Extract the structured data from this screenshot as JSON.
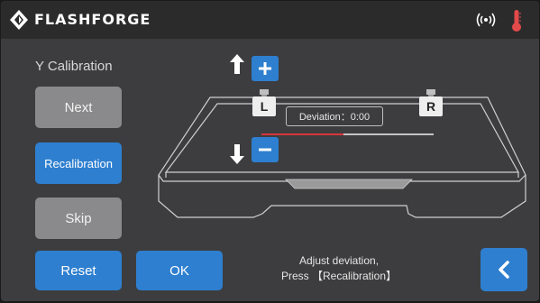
{
  "header": {
    "brand": "FLASHFORGE",
    "logo_icon": "flashforge-logo-icon",
    "wifi_icon": "wifi-signal-icon",
    "temperature_icon": "thermometer-icon"
  },
  "page": {
    "title": "Y Calibration"
  },
  "buttons": {
    "next": "Next",
    "recalibration": "Recalibration",
    "skip": "Skip",
    "reset": "Reset",
    "ok": "OK"
  },
  "calibration": {
    "left_nozzle": "L",
    "right_nozzle": "R",
    "deviation": "Deviation：0:00",
    "increase_icon": "plus-icon",
    "decrease_icon": "minus-icon"
  },
  "instruction": {
    "line1": "Adjust deviation,",
    "line2": "Press 【Recalibration】"
  },
  "colors": {
    "accent": "#2e7fcf",
    "button_gray": "#8a8a8c",
    "background": "#3d3d3f",
    "header": "#2b2b2c",
    "temperature": "#e34a4a",
    "deviation_line": "#d9353a"
  }
}
